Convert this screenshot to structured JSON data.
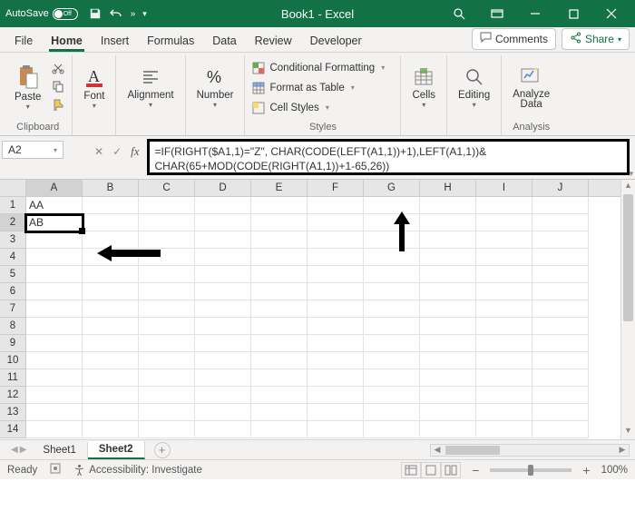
{
  "titlebar": {
    "autosave_label": "AutoSave",
    "autosave_state": "Off",
    "title": "Book1 - Excel"
  },
  "tabs": {
    "file": "File",
    "home": "Home",
    "insert": "Insert",
    "formulas": "Formulas",
    "data": "Data",
    "review": "Review",
    "developer": "Developer",
    "comments": "Comments",
    "share": "Share"
  },
  "ribbon": {
    "clipboard": {
      "label": "Clipboard",
      "paste": "Paste"
    },
    "font": {
      "label": "Font"
    },
    "alignment": {
      "label": "Alignment"
    },
    "number": {
      "label": "Number"
    },
    "styles": {
      "label": "Styles",
      "cond": "Conditional Formatting",
      "fat": "Format as Table",
      "cellstyles": "Cell Styles"
    },
    "cells": {
      "label": "Cells"
    },
    "editing": {
      "label": "Editing"
    },
    "analysis": {
      "label": "Analysis",
      "analyze": "Analyze",
      "data": "Data"
    }
  },
  "formula": {
    "namebox": "A2",
    "text": "=IF(RIGHT($A1,1)=\"Z\", CHAR(CODE(LEFT(A1,1))+1),LEFT(A1,1))& CHAR(65+MOD(CODE(RIGHT(A1,1))+1-65,26))"
  },
  "grid": {
    "cols": [
      "A",
      "B",
      "C",
      "D",
      "E",
      "F",
      "G",
      "H",
      "I",
      "J"
    ],
    "rows": [
      "1",
      "2",
      "3",
      "4",
      "5",
      "6",
      "7",
      "8",
      "9",
      "10",
      "11",
      "12",
      "13",
      "14"
    ],
    "cells": {
      "A1": "AA",
      "A2": "AB"
    },
    "selected_col": "A",
    "selected_row": "2"
  },
  "sheets": {
    "s1": "Sheet1",
    "s2": "Sheet2"
  },
  "status": {
    "ready": "Ready",
    "access": "Accessibility: Investigate",
    "zoom": "100%"
  }
}
